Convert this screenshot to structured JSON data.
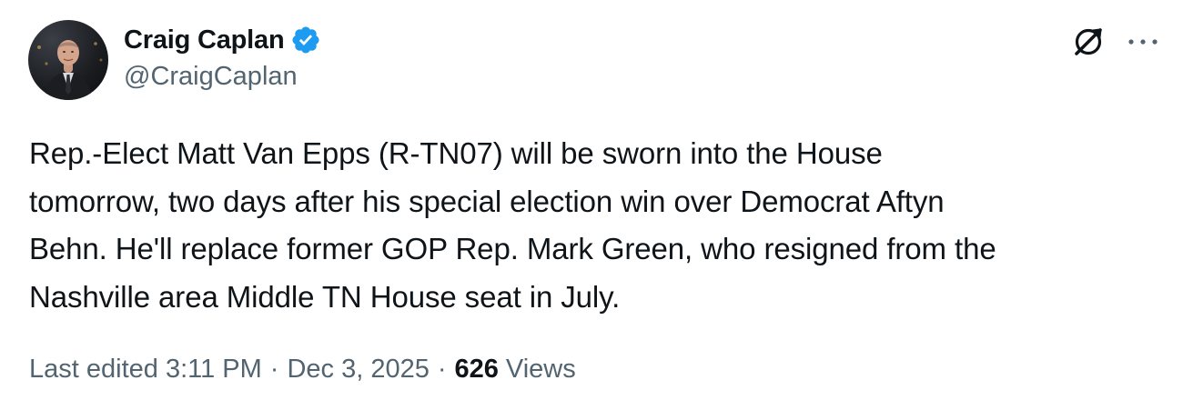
{
  "author": {
    "display_name": "Craig Caplan",
    "handle": "@CraigCaplan",
    "verified": true,
    "verified_color": "#1d9bf0",
    "avatar_icon": "profile-photo"
  },
  "actions": {
    "grok_icon": "grok-icon",
    "more_icon": "more-dots-icon"
  },
  "tweet": {
    "text": "Rep.-Elect Matt Van Epps (R-TN07) will be sworn into the House\ntomorrow, two days after his special election win over Democrat Aftyn\nBehn. He'll replace former GOP Rep. Mark Green, who resigned from the\nNashville area Middle TN House seat in July."
  },
  "meta": {
    "edited_label": "Last edited 3:11 PM",
    "separator": "·",
    "date": "Dec 3, 2025",
    "views_count": "626",
    "views_label": "Views"
  },
  "colors": {
    "text_primary": "#0f1419",
    "text_secondary": "#536471",
    "accent": "#1d9bf0"
  }
}
